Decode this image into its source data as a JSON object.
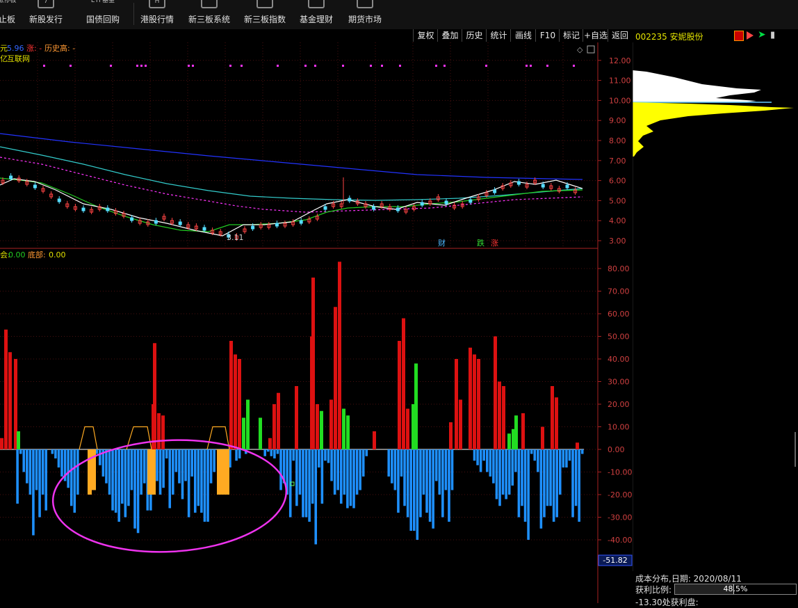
{
  "toolbar_top": [
    {
      "label": "止板",
      "top_hint": "涨停板"
    },
    {
      "label": "新股发行",
      "top_hint": "7"
    },
    {
      "label": "国债回购",
      "top_hint": "ETF基金"
    },
    {
      "label": "港股行情",
      "top_hint": "H"
    },
    {
      "label": "新三板系统",
      "top_hint": ""
    },
    {
      "label": "新三板指数",
      "top_hint": ""
    },
    {
      "label": "基金理财",
      "top_hint": ""
    },
    {
      "label": "期货市场",
      "top_hint": ""
    }
  ],
  "chart_tools": [
    "复权",
    "叠加",
    "历史",
    "统计",
    "画线",
    "F10",
    "标记",
    "+自选",
    "返回"
  ],
  "stock": {
    "code_name": "002235 安妮股份"
  },
  "price_panel": {
    "header_ma": "5.96",
    "header_zhang": "涨: -",
    "header_lishi": "历史高: -",
    "sector": "互联网",
    "low_label": "3.11",
    "tags": [
      {
        "text": "财",
        "color": "#4db8ff"
      },
      {
        "text": "跌",
        "color": "#33dd33"
      },
      {
        "text": "涨",
        "color": "#ff3333"
      }
    ],
    "yaxis": [
      "12.00",
      "11.00",
      "10.00",
      "9.00",
      "8.00",
      "7.00",
      "6.00",
      "5.00",
      "4.00",
      "3.00"
    ]
  },
  "indicator_panel": {
    "header_a": "0.00",
    "header_b_label": "底部:",
    "header_b": "0.00",
    "yaxis": [
      "80.00",
      "70.00",
      "60.00",
      "50.00",
      "40.00",
      "30.00",
      "20.00",
      "10.00",
      "0.00",
      "-10.00",
      "-20.00",
      "-30.00",
      "-40.00"
    ],
    "current_value": "-51.82"
  },
  "chip_info": {
    "line1": "成本分布,日期: 2020/08/11",
    "profit_label": "获利比例:",
    "profit_value": "48.5%",
    "line3": "-13.30处获利盘:"
  },
  "chart_data": {
    "type": "bar",
    "title": "",
    "ylim": [
      -51.82,
      85
    ],
    "values": [
      5,
      53,
      43,
      40,
      8,
      -24,
      -2,
      -10,
      -15,
      -20,
      -38,
      -18,
      -30,
      -20,
      -27,
      4,
      -2,
      -4,
      -8,
      -12,
      -14,
      -17,
      -25,
      -28,
      -20,
      3,
      2,
      4,
      -2,
      -6,
      -2,
      -7,
      -12,
      -15,
      -20,
      -27,
      -28,
      -32,
      -24,
      -30,
      -25,
      -18,
      -35,
      -37,
      -20,
      -15,
      -27,
      -27,
      -18,
      -14,
      -20,
      -17,
      -4,
      -26,
      -20,
      -10,
      -15,
      -22,
      -14,
      -30,
      -12,
      -28,
      -25,
      -28,
      -32,
      -32,
      -15,
      -10,
      45,
      40,
      -2,
      -5,
      -8,
      0,
      -5,
      -4,
      0,
      -2,
      0,
      6,
      2,
      3,
      8,
      -3,
      -1,
      -3,
      -4,
      -2,
      -18,
      -15,
      -20,
      -30,
      -5,
      -25,
      -20,
      -30,
      -30,
      -32,
      -24,
      -42,
      -8,
      -24,
      -5,
      -6,
      -14,
      -20,
      -18,
      -24,
      -20,
      -26,
      -25,
      -26,
      -20,
      -18,
      -12,
      -3,
      0,
      0,
      0,
      0,
      0,
      0,
      -12,
      -15,
      -18,
      -28,
      -12,
      -25,
      -30,
      -36,
      -36,
      -40,
      -30,
      -20,
      -28,
      -32,
      -35,
      -14,
      -20,
      -30,
      -18,
      -32,
      -18,
      0,
      0,
      0,
      0,
      0,
      0,
      -5,
      -7,
      -10,
      -5,
      -10,
      -12,
      -15,
      -22,
      -25,
      -20,
      -22,
      -20,
      -16,
      -10,
      -30,
      -25,
      -32,
      -40,
      -2,
      -5,
      -10,
      -35,
      -30,
      -25,
      -25,
      -32,
      -30,
      -20,
      -8,
      -8,
      -5,
      -30,
      -25,
      -32,
      -2
    ]
  }
}
